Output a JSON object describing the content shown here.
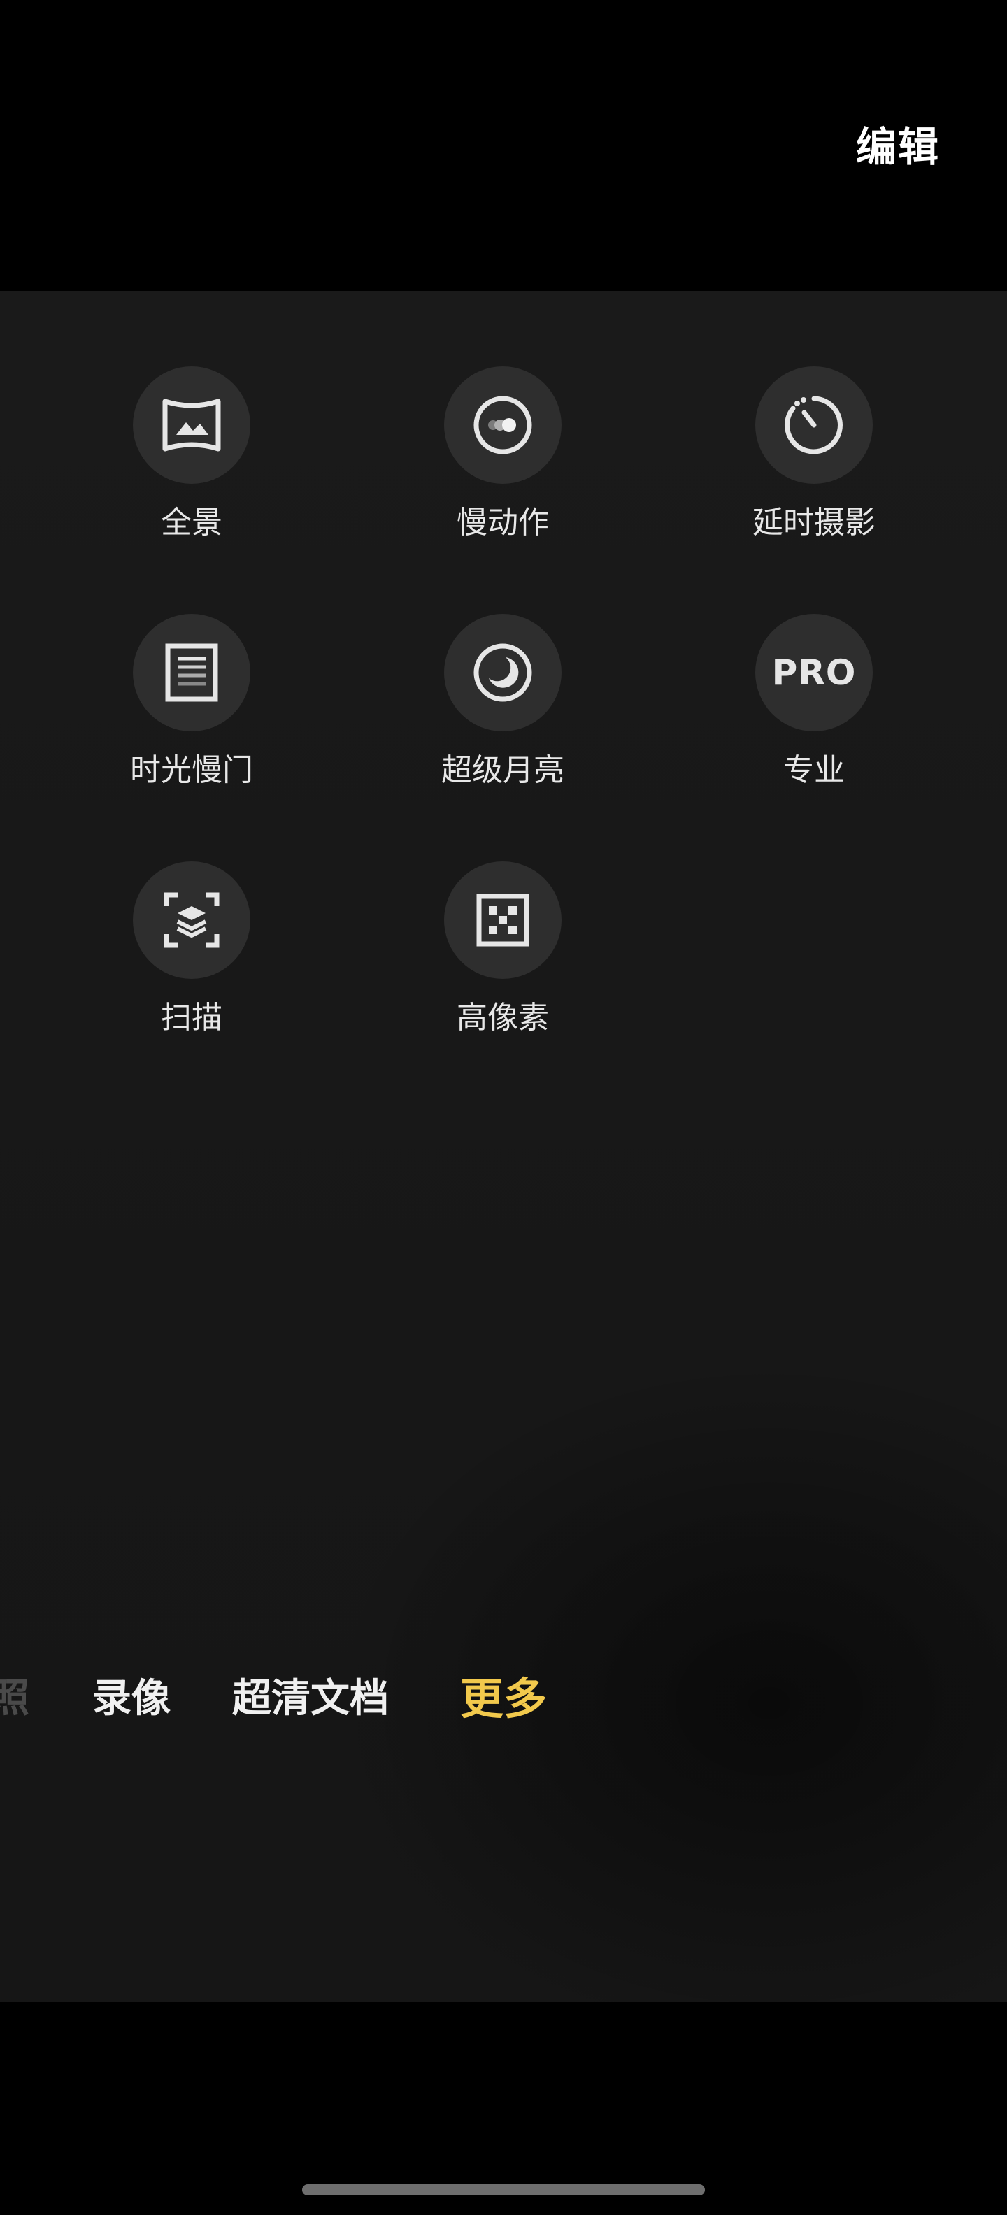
{
  "header": {
    "edit_label": "编辑"
  },
  "modes": [
    {
      "label": "全景",
      "icon": "panorama-icon"
    },
    {
      "label": "慢动作",
      "icon": "slow-motion-icon"
    },
    {
      "label": "延时摄影",
      "icon": "timelapse-icon"
    },
    {
      "label": "时光慢门",
      "icon": "long-exposure-icon"
    },
    {
      "label": "超级月亮",
      "icon": "super-moon-icon"
    },
    {
      "label": "专业",
      "icon": "pro-icon",
      "icon_text": "PRO"
    },
    {
      "label": "扫描",
      "icon": "scan-icon"
    },
    {
      "label": "高像素",
      "icon": "high-pixel-icon"
    }
  ],
  "bottom_tabs": [
    {
      "label": "照",
      "state": "faded"
    },
    {
      "label": "录像",
      "state": "normal"
    },
    {
      "label": "超清文档",
      "state": "normal"
    },
    {
      "label": "更多",
      "state": "selected"
    }
  ],
  "colors": {
    "background": "#000000",
    "panel": "#1a1a1a",
    "icon_circle": "#2e2e2e",
    "label": "#e8e8e8",
    "selected_tab": "#f2c94c",
    "faded_tab": "#4a4a4a"
  }
}
